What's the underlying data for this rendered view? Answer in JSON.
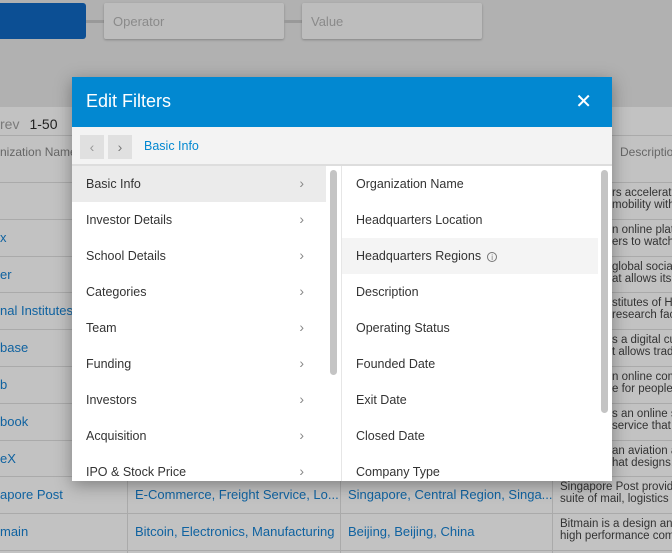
{
  "filter_bar": {
    "operator_placeholder": "Operator",
    "value_placeholder": "Value"
  },
  "table": {
    "pager_prev": "rev",
    "pager_range": "1-50",
    "headers": {
      "name": "nization Name",
      "description": "Description"
    },
    "rows": [
      {
        "name": "",
        "desc": [
          "rs accelerat",
          "mobility with"
        ]
      },
      {
        "name": "x",
        "desc": [
          "n online plat",
          "ers to watch"
        ]
      },
      {
        "name": "er",
        "desc": [
          "global socia",
          "at allows its"
        ]
      },
      {
        "name": "nal Institutes",
        "desc": [
          "stitutes of H",
          "research fac"
        ]
      },
      {
        "name": "base",
        "desc": [
          "s a digital cu",
          "t allows trad"
        ]
      },
      {
        "name": "b",
        "desc": [
          "n online com",
          "e for people"
        ]
      },
      {
        "name": "book",
        "desc": [
          "s an online s",
          "service that"
        ]
      },
      {
        "name": "eX",
        "desc": [
          "an aviation a",
          "hat designs,"
        ]
      },
      {
        "name": "apore Post",
        "industries": "E-Commerce, Freight Service, Lo...",
        "hq": "Singapore, Central Region, Singa...",
        "desc": [
          "Singapore Post provide",
          "suite of mail, logistics a"
        ]
      },
      {
        "name": "main",
        "industries": "Bitcoin, Electronics, Manufacturing",
        "hq": "Beijing, Beijing, China",
        "desc": [
          "Bitmain is a design and",
          "high performance comp"
        ]
      }
    ]
  },
  "modal": {
    "title": "Edit Filters",
    "close_icon": "close-icon",
    "breadcrumb": "Basic Info",
    "categories": [
      "Basic Info",
      "Investor Details",
      "School Details",
      "Categories",
      "Team",
      "Funding",
      "Investors",
      "Acquisition",
      "IPO & Stock Price"
    ],
    "fields": [
      "Organization Name",
      "Headquarters Location",
      "Headquarters Regions",
      "Description",
      "Operating Status",
      "Founded Date",
      "Exit Date",
      "Closed Date",
      "Company Type"
    ],
    "accent": "#0288d1"
  }
}
